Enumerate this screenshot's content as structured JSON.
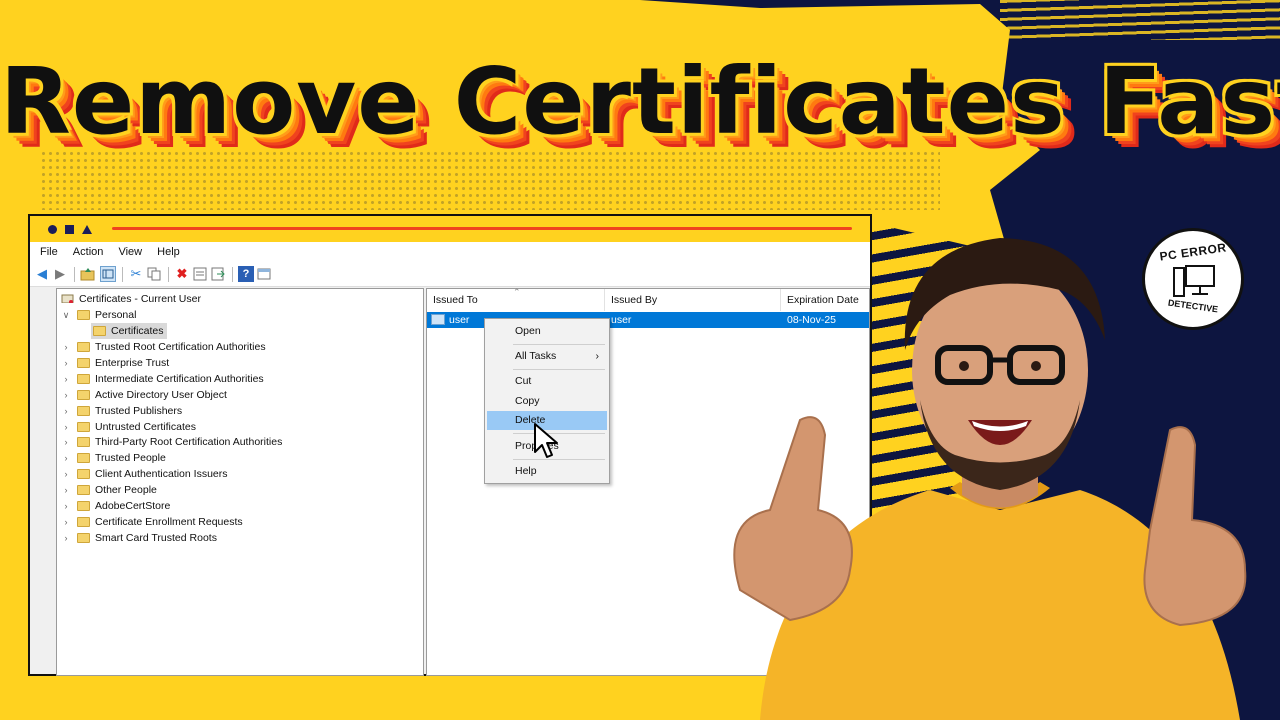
{
  "headline": "Remove Certificates Fast",
  "menu": [
    "File",
    "Action",
    "View",
    "Help"
  ],
  "tree": {
    "root": "Certificates - Current User",
    "personal": "Personal",
    "certificates": "Certificates",
    "items": [
      "Trusted Root Certification Authorities",
      "Enterprise Trust",
      "Intermediate Certification Authorities",
      "Active Directory User Object",
      "Trusted Publishers",
      "Untrusted Certificates",
      "Third-Party Root Certification Authorities",
      "Trusted People",
      "Client Authentication Issuers",
      "Other People",
      "AdobeCertStore",
      "Certificate Enrollment Requests",
      "Smart Card Trusted Roots"
    ]
  },
  "list": {
    "columns": [
      "Issued To",
      "Issued By",
      "Expiration Date"
    ],
    "row": {
      "issued_to": "user",
      "issued_by": "user",
      "expiration": "08-Nov-25"
    }
  },
  "context_menu": {
    "open": "Open",
    "all_tasks": "All Tasks",
    "submenu_arrow": "›",
    "cut": "Cut",
    "copy": "Copy",
    "delete": "Delete",
    "properties": "Prop  es",
    "help": "Help"
  },
  "badge": {
    "top": "PC ERROR",
    "bottom": "DETECTIVE"
  },
  "icons": {
    "back": "arrow-left-icon",
    "forward": "arrow-right-icon",
    "up": "folder-up-icon",
    "show": "console-tree-icon",
    "cut": "scissors-icon",
    "copy": "copy-icon",
    "delete": "delete-icon",
    "properties": "properties-icon",
    "export": "export-icon",
    "help": "help-icon",
    "view": "view-icon"
  },
  "colors": {
    "yellow": "#ffd21f",
    "navy": "#0d1540",
    "accent_red": "#f0431e",
    "selection": "#0078d7"
  }
}
